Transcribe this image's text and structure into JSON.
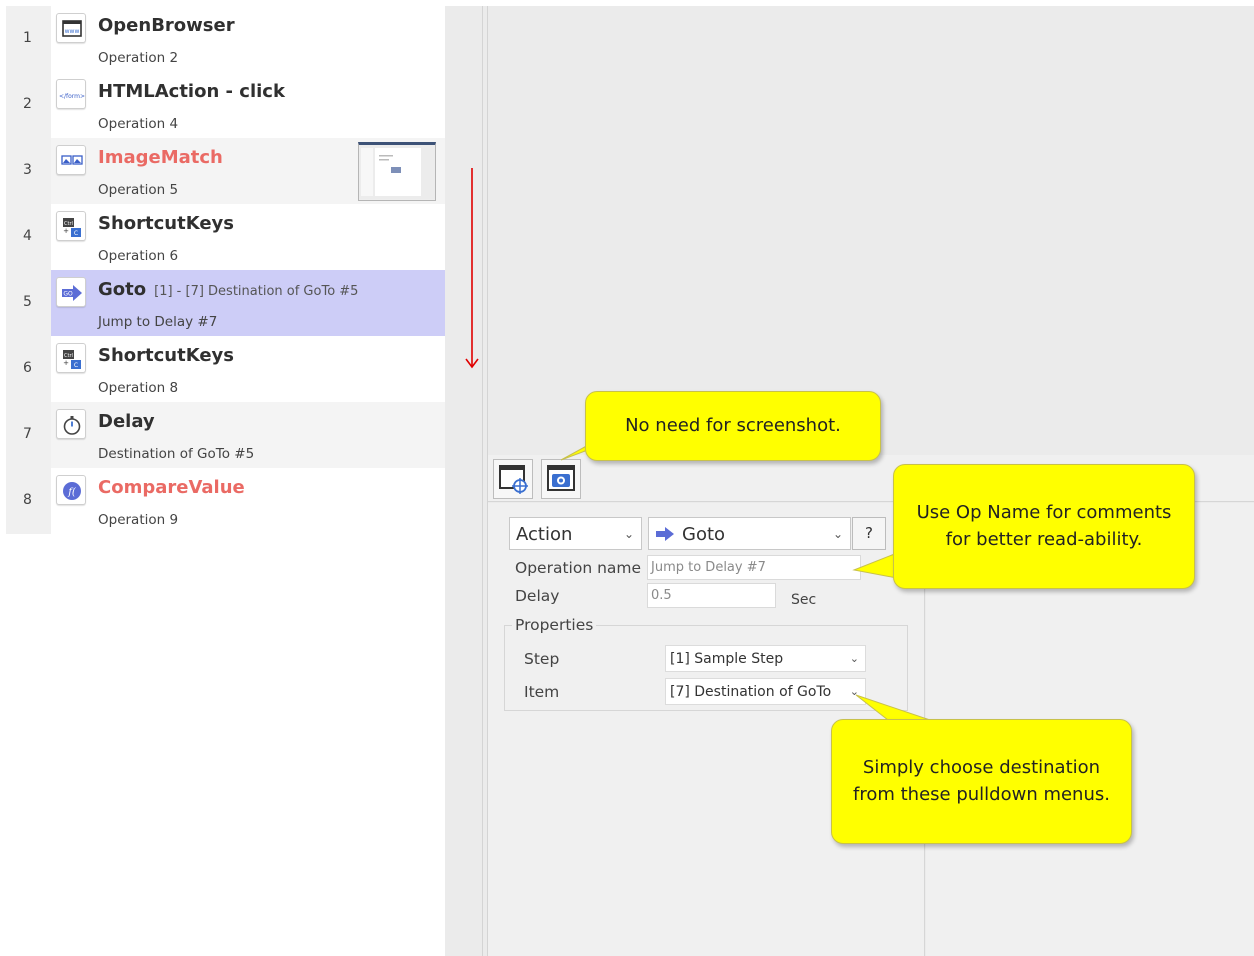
{
  "operations": [
    {
      "num": "1",
      "title": "OpenBrowser",
      "sub": "Operation 2",
      "icon": "browser-www-icon",
      "extra": "",
      "title_color": "normal"
    },
    {
      "num": "2",
      "title": "HTMLAction - click",
      "sub": "Operation 4",
      "icon": "html-form-icon",
      "extra": "",
      "title_color": "normal"
    },
    {
      "num": "3",
      "title": "ImageMatch",
      "sub": "Operation 5",
      "icon": "image-match-icon",
      "extra": "",
      "title_color": "red"
    },
    {
      "num": "4",
      "title": "ShortcutKeys",
      "sub": "Operation 6",
      "icon": "shortcut-keys-icon",
      "extra": "",
      "title_color": "normal"
    },
    {
      "num": "5",
      "title": "Goto",
      "sub": "Jump to Delay #7",
      "icon": "goto-icon",
      "extra": "[1] - [7] Destination of GoTo #5",
      "title_color": "normal"
    },
    {
      "num": "6",
      "title": "ShortcutKeys",
      "sub": "Operation 8",
      "icon": "shortcut-keys-icon",
      "extra": "",
      "title_color": "normal"
    },
    {
      "num": "7",
      "title": "Delay",
      "sub": "Destination of GoTo #5",
      "icon": "stopwatch-icon",
      "extra": "",
      "title_color": "normal"
    },
    {
      "num": "8",
      "title": "CompareValue",
      "sub": "Operation 9",
      "icon": "compare-value-icon",
      "extra": "",
      "title_color": "red"
    }
  ],
  "selected_operation": "5",
  "properties_panel": {
    "type_select": "Action",
    "action_select": "Goto",
    "help_label": "?",
    "op_name_label": "Operation name",
    "op_name_value": "Jump to Delay #7",
    "delay_label": "Delay",
    "delay_value": "0.5",
    "delay_unit": "Sec",
    "group_title": "Properties",
    "step_label": "Step",
    "step_value": "[1] Sample Step",
    "item_label": "Item",
    "item_value": "[7] Destination of GoTo"
  },
  "callouts": {
    "screenshot": "No need for screenshot.",
    "op_name_line1": "Use Op Name for comments",
    "op_name_line2": "for better read-ability.",
    "pulldown_line1": "Simply choose destination",
    "pulldown_line2": "from these pulldown menus."
  },
  "colors": {
    "selected_row": "#cdcdf7",
    "red_title": "#ea6a64",
    "callout": "#ffff00",
    "arrow": "#e00000"
  }
}
